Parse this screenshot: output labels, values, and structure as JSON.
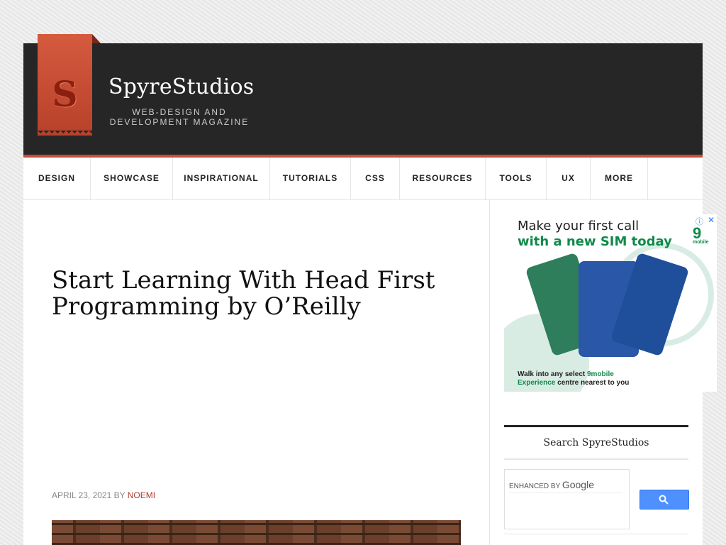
{
  "brand": {
    "logo_letter": "S",
    "title": "SpyreStudios",
    "tagline_line1": "WEB-DESIGN AND",
    "tagline_line2": "DEVELOPMENT MAGAZINE"
  },
  "nav": {
    "items": [
      {
        "label": "DESIGN"
      },
      {
        "label": "SHOWCASE"
      },
      {
        "label": "INSPIRATIONAL"
      },
      {
        "label": "TUTORIALS"
      },
      {
        "label": "CSS"
      },
      {
        "label": "RESOURCES"
      },
      {
        "label": "TOOLS"
      },
      {
        "label": "UX"
      },
      {
        "label": "MORE"
      }
    ]
  },
  "post": {
    "title": "Start Learning With Head First Programming by O’Reilly",
    "date": "APRIL 23, 2021",
    "by": "BY",
    "author": "NOEMI"
  },
  "ad": {
    "headline1": "Make your first call",
    "headline2": "with a new SIM today",
    "brand_mark": "9",
    "brand_word": "mobile",
    "footer_line1_a": "Walk into any select",
    "footer_line1_b": "9mobile",
    "footer_line2_a": "Experience",
    "footer_line2_b": "centre nearest to you",
    "info_icon": "ⓘ",
    "close_icon": "✕"
  },
  "sidebar": {
    "search_widget_title": "Search SpyreStudios",
    "search_label": "ENHANCED BY",
    "search_provider": "Google"
  },
  "colors": {
    "header_bg": "#262626",
    "accent": "#c44f37",
    "link": "#b03a2e",
    "ad_green": "#0f8a4a",
    "search_button": "#4d90fe"
  }
}
